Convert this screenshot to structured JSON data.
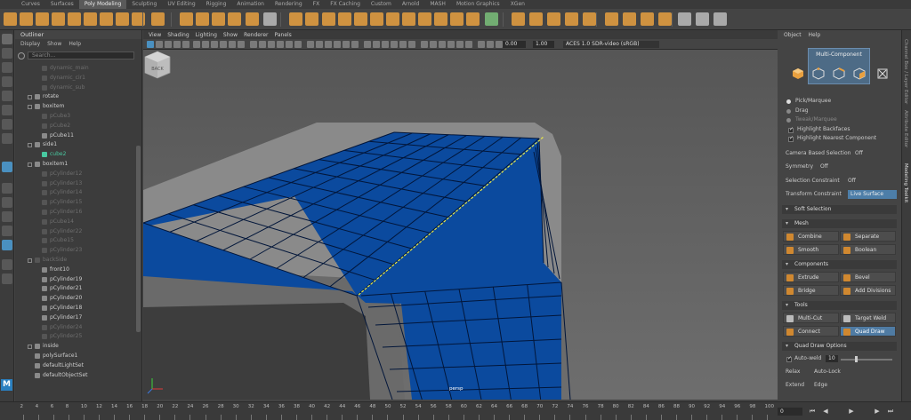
{
  "shelf_tabs": [
    "Curves",
    "Surfaces",
    "Poly Modeling",
    "Sculpting",
    "UV Editing",
    "Rigging",
    "Animation",
    "Rendering",
    "FX",
    "FX Caching",
    "Custom",
    "Arnold",
    "MASH",
    "Motion Graphics",
    "XGen"
  ],
  "active_shelf_tab": "Poly Modeling",
  "outliner": {
    "title": "Outliner",
    "menu": [
      "Display",
      "Show",
      "Help"
    ],
    "search_placeholder": "Search...",
    "items": [
      {
        "label": "dynamic_main",
        "indent": 2,
        "hidden": true,
        "expand": false
      },
      {
        "label": "dynamic_cir1",
        "indent": 2,
        "hidden": true,
        "expand": false
      },
      {
        "label": "dynamic_sub",
        "indent": 2,
        "hidden": true,
        "expand": false
      },
      {
        "label": "rotate",
        "indent": 1,
        "hidden": false,
        "expand": true
      },
      {
        "label": "boxitem",
        "indent": 1,
        "hidden": false,
        "expand": true
      },
      {
        "label": "pCube3",
        "indent": 2,
        "hidden": true,
        "expand": false
      },
      {
        "label": "pCube2",
        "indent": 2,
        "hidden": true,
        "expand": false
      },
      {
        "label": "pCube11",
        "indent": 2,
        "hidden": false,
        "expand": false
      },
      {
        "label": "side1",
        "indent": 1,
        "hidden": false,
        "expand": true
      },
      {
        "label": "cube2",
        "indent": 2,
        "hidden": false,
        "sel": true,
        "expand": false
      },
      {
        "label": "boxitem1",
        "indent": 1,
        "hidden": false,
        "expand": true
      },
      {
        "label": "pCylinder12",
        "indent": 2,
        "hidden": true,
        "expand": false
      },
      {
        "label": "pCylinder13",
        "indent": 2,
        "hidden": true,
        "expand": false
      },
      {
        "label": "pCylinder14",
        "indent": 2,
        "hidden": true,
        "expand": false
      },
      {
        "label": "pCylinder15",
        "indent": 2,
        "hidden": true,
        "expand": false
      },
      {
        "label": "pCylinder16",
        "indent": 2,
        "hidden": true,
        "expand": false
      },
      {
        "label": "pCube14",
        "indent": 2,
        "hidden": true,
        "expand": false
      },
      {
        "label": "pCylinder22",
        "indent": 2,
        "hidden": true,
        "expand": false
      },
      {
        "label": "pCube15",
        "indent": 2,
        "hidden": true,
        "expand": false
      },
      {
        "label": "pCylinder23",
        "indent": 2,
        "hidden": true,
        "expand": false
      },
      {
        "label": "backSide",
        "indent": 1,
        "hidden": true,
        "expand": true
      },
      {
        "label": "front10",
        "indent": 2,
        "hidden": false,
        "expand": false
      },
      {
        "label": "pCylinder19",
        "indent": 2,
        "hidden": false,
        "expand": false
      },
      {
        "label": "pCylinder21",
        "indent": 2,
        "hidden": false,
        "expand": false
      },
      {
        "label": "pCylinder20",
        "indent": 2,
        "hidden": false,
        "expand": false
      },
      {
        "label": "pCylinder18",
        "indent": 2,
        "hidden": false,
        "expand": false
      },
      {
        "label": "pCylinder17",
        "indent": 2,
        "hidden": false,
        "expand": false
      },
      {
        "label": "pCylinder24",
        "indent": 2,
        "hidden": true,
        "expand": false
      },
      {
        "label": "pCylinder25",
        "indent": 2,
        "hidden": true,
        "expand": false
      },
      {
        "label": "inside",
        "indent": 1,
        "hidden": false,
        "expand": true
      },
      {
        "label": "polySurface1",
        "indent": 1,
        "hidden": false,
        "expand": false
      },
      {
        "label": "defaultLightSet",
        "indent": 1,
        "hidden": false,
        "expand": false
      },
      {
        "label": "defaultObjectSet",
        "indent": 1,
        "hidden": false,
        "expand": false
      }
    ]
  },
  "viewport": {
    "menu": [
      "View",
      "Shading",
      "Lighting",
      "Show",
      "Renderer",
      "Panels"
    ],
    "field_a": "0.00",
    "field_b": "1.00",
    "color_space": "ACES 1.0 SDR-video (sRGB)",
    "camera_label": "persp",
    "viewcube_label": "BACK"
  },
  "side_strip": [
    "Channel Box / Layer Editor",
    "Attribute Editor",
    "Modeling Toolkit"
  ],
  "toolkit": {
    "menu": [
      "Object",
      "Help"
    ],
    "mode_title": "Multi-Component",
    "pick_marquee": "Pick/Marquee",
    "drag": "Drag",
    "tweak_marquee": "Tweak/Marquee",
    "highlight_backfaces": "Highlight Backfaces",
    "highlight_nearest": "Highlight Nearest Component",
    "camera_selection": "Camera Based Selection",
    "camera_selection_val": "Off",
    "symmetry": "Symmetry",
    "symmetry_val": "Off",
    "selection_constraint": "Selection Constraint",
    "selection_constraint_val": "Off",
    "transform_constraint": "Transform Constraint",
    "transform_constraint_val": "Live Surface",
    "soft_selection": "Soft Selection",
    "mesh": "Mesh",
    "combine": "Combine",
    "separate": "Separate",
    "smooth": "Smooth",
    "boolean": "Boolean",
    "components": "Components",
    "extrude": "Extrude",
    "bevel": "Bevel",
    "bridge": "Bridge",
    "add_divisions": "Add Divisions",
    "tools": "Tools",
    "multi_cut": "Multi-Cut",
    "target_weld": "Target Weld",
    "connect": "Connect",
    "quad_draw": "Quad Draw",
    "quad_draw_options": "Quad Draw Options",
    "auto_weld": "Auto-weld",
    "auto_weld_val": "10",
    "relax": "Relax",
    "auto_lock": "Auto-Lock",
    "extend": "Extend",
    "edge": "Edge"
  },
  "timeline": {
    "ticks": [
      "2",
      "4",
      "6",
      "8",
      "10",
      "12",
      "14",
      "16",
      "18",
      "20",
      "22",
      "24",
      "26",
      "28",
      "30",
      "32",
      "34",
      "36",
      "38",
      "40",
      "42",
      "44",
      "46",
      "48",
      "50",
      "52",
      "54",
      "56",
      "58",
      "60",
      "62",
      "64",
      "66",
      "68",
      "70",
      "72",
      "74",
      "76",
      "78",
      "80",
      "82",
      "84",
      "86",
      "88",
      "90",
      "92",
      "94",
      "96",
      "98",
      "100"
    ],
    "frame": "0"
  },
  "maya_logo": "M",
  "colors": {
    "accent": "#4f7ba3",
    "mesh_face": "#0b4a9e",
    "mesh_edge": "#02163a",
    "highlight_edge": "#e8e84a"
  }
}
